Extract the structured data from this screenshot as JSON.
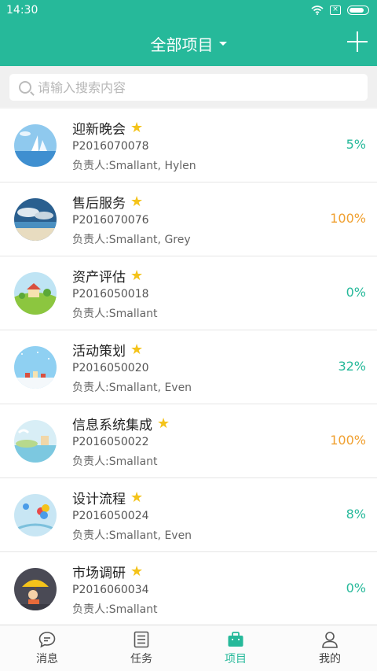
{
  "status_bar": {
    "time": "14:30"
  },
  "header": {
    "title": "全部项目"
  },
  "search": {
    "placeholder": "请输入搜索内容"
  },
  "colors": {
    "accent": "#26b99a",
    "progress_low": "#26b99a",
    "progress_done": "#f0a030",
    "star": "#f4c31a"
  },
  "projects": [
    {
      "name": "迎新晚会",
      "code": "P2016070078",
      "owner": "负责人:Smallant, Hylen",
      "progress": "5%",
      "starred": true
    },
    {
      "name": "售后服务",
      "code": "P2016070076",
      "owner": "负责人:Smallant, Grey",
      "progress": "100%",
      "starred": true
    },
    {
      "name": "资产评估",
      "code": "P2016050018",
      "owner": "负责人:Smallant",
      "progress": "0%",
      "starred": true
    },
    {
      "name": "活动策划",
      "code": "P2016050020",
      "owner": "负责人:Smallant, Even",
      "progress": "32%",
      "starred": true
    },
    {
      "name": "信息系统集成",
      "code": "P2016050022",
      "owner": "负责人:Smallant",
      "progress": "100%",
      "starred": true
    },
    {
      "name": "设计流程",
      "code": "P2016050024",
      "owner": "负责人:Smallant, Even",
      "progress": "8%",
      "starred": true
    },
    {
      "name": "市场调研",
      "code": "P2016060034",
      "owner": "负责人:Smallant",
      "progress": "0%",
      "starred": true
    }
  ],
  "tabbar": {
    "tabs": [
      {
        "label": "消息",
        "icon": "chat-bubble-icon"
      },
      {
        "label": "任务",
        "icon": "task-list-icon"
      },
      {
        "label": "项目",
        "icon": "briefcase-icon",
        "active": true
      },
      {
        "label": "我的",
        "icon": "person-icon"
      }
    ]
  }
}
